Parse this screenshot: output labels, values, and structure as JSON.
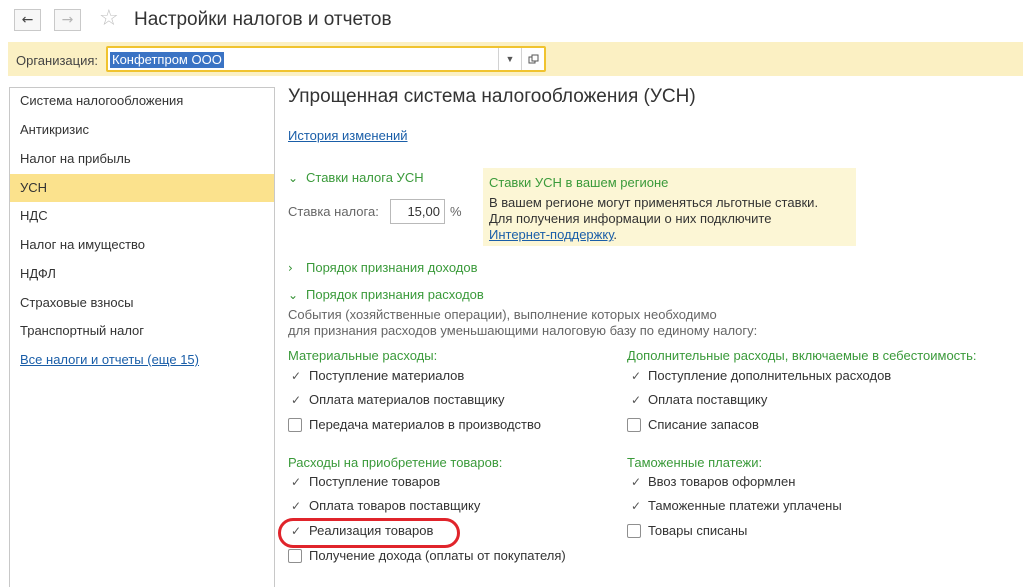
{
  "window": {
    "title": "Настройки налогов и отчетов",
    "back_icon": "arrow-left-icon",
    "forward_icon": "arrow-right-icon",
    "favorite_icon": "star-icon"
  },
  "org": {
    "label": "Организация:",
    "value": "Конфетпром ООО"
  },
  "sidebar": {
    "items": [
      {
        "label": "Система налогообложения"
      },
      {
        "label": "Антикризис"
      },
      {
        "label": "Налог на прибыль"
      },
      {
        "label": "УСН"
      },
      {
        "label": "НДС"
      },
      {
        "label": "Налог на имущество"
      },
      {
        "label": "НДФЛ"
      },
      {
        "label": "Страховые взносы"
      },
      {
        "label": "Транспортный налог"
      }
    ],
    "active_index": 3,
    "more_link": "Все налоги и отчеты (еще 15)"
  },
  "main": {
    "title": "Упрощенная система налогообложения (УСН)",
    "history_link": "История изменений",
    "rates_section": "Ставки налога УСН",
    "rate_label": "Ставка налога:",
    "rate_value": "15,00",
    "rate_unit": "%",
    "notice": {
      "title": "Ставки УСН в вашем регионе",
      "line1": "В вашем регионе могут применяться льготные ставки.",
      "line2": "Для получения информации о них подключите",
      "link": "Интернет-поддержку",
      "tail": "."
    },
    "income_section": "Порядок признания доходов",
    "expense_section": "Порядок признания расходов",
    "expense_desc1": "События (хозяйственные операции), выполнение которых необходимо",
    "expense_desc2": "для признания расходов уменьшающими налоговую базу по единому налогу:",
    "material": {
      "title": "Материальные расходы:",
      "items": [
        {
          "label": "Поступление материалов",
          "checked": true
        },
        {
          "label": "Оплата материалов поставщику",
          "checked": true
        },
        {
          "label": "Передача материалов в производство",
          "checked": false
        }
      ]
    },
    "additional": {
      "title": "Дополнительные расходы, включаемые в себестоимость:",
      "items": [
        {
          "label": "Поступление дополнительных расходов",
          "checked": true
        },
        {
          "label": "Оплата поставщику",
          "checked": true
        },
        {
          "label": "Списание запасов",
          "checked": false
        }
      ]
    },
    "goods": {
      "title": "Расходы на приобретение товаров:",
      "items": [
        {
          "label": "Поступление товаров",
          "checked": true
        },
        {
          "label": "Оплата товаров поставщику",
          "checked": true
        },
        {
          "label": "Реализация товаров",
          "checked": true
        },
        {
          "label": "Получение дохода (оплаты от покупателя)",
          "checked": false
        }
      ]
    },
    "customs": {
      "title": "Таможенные платежи:",
      "items": [
        {
          "label": "Ввоз товаров оформлен",
          "checked": true
        },
        {
          "label": "Таможенные платежи уплачены",
          "checked": true
        },
        {
          "label": "Товары списаны",
          "checked": false
        }
      ]
    }
  },
  "colors": {
    "accent_yellow": "#fbe28d",
    "org_bar": "#fbf0c3",
    "link_blue": "#1a5ea8",
    "section_green": "#3a9a3a",
    "highlight_red": "#e0242b"
  }
}
